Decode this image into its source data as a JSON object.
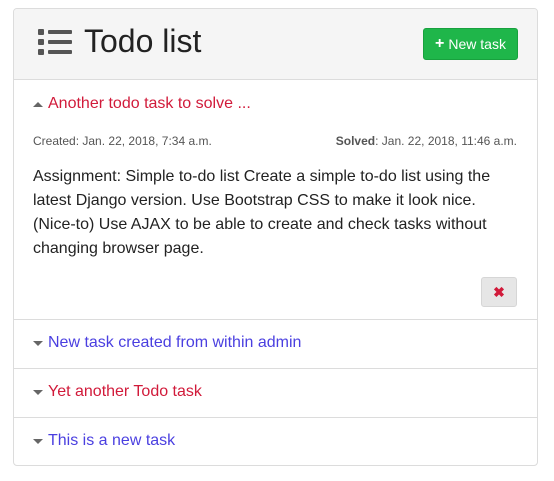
{
  "header": {
    "title": "Todo list",
    "new_task_label": "New task",
    "new_task_icon": "plus-icon",
    "title_icon": "list-icon"
  },
  "colors": {
    "open_task": "#d11a3a",
    "solved_task": "#4a3fe0",
    "new_button": "#1fb64a"
  },
  "tasks": [
    {
      "title": "Another todo task to solve ...",
      "expanded": true,
      "created_label": "Created:",
      "created_value": "Jan. 22, 2018, 7:34 a.m.",
      "solved_label": "Solved",
      "solved_value": ": Jan. 22, 2018, 11:46 a.m.",
      "body": "Assignment: Simple to-do list Create a simple to-do list using the latest Django version. Use Bootstrap CSS to make it look nice. (Nice-to) Use AJAX to be able to create and check tasks without changing browser page.",
      "delete_glyph": "✖"
    },
    {
      "title": "New task created from within admin",
      "expanded": false
    },
    {
      "title": "Yet another Todo task",
      "expanded": false
    },
    {
      "title": "This is a new task",
      "expanded": false
    }
  ]
}
